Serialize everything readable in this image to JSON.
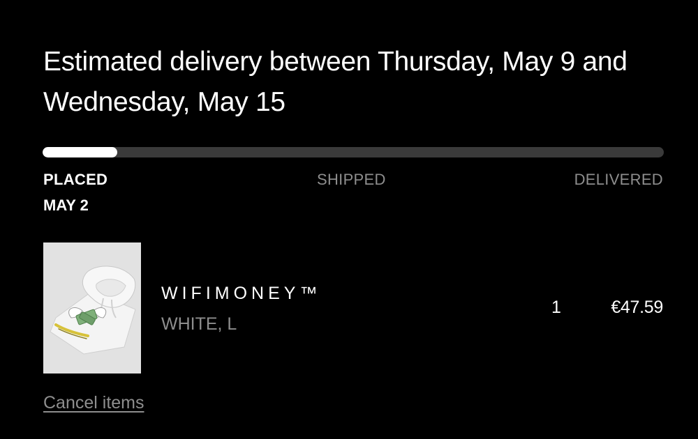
{
  "order": {
    "estimated_delivery": "Estimated delivery between Thursday, May 9 and Wednesday, May 15",
    "progress_fraction": 0.12,
    "steps": [
      {
        "label": "PLACED",
        "date": "MAY 2",
        "active": true
      },
      {
        "label": "SHIPPED",
        "active": false
      },
      {
        "label": "DELIVERED",
        "active": false
      }
    ]
  },
  "item": {
    "name": "WIFIMONEY™",
    "variant": "WHITE, L",
    "quantity": "1",
    "price": "€47.59",
    "thumbnail_icon": "white-hoodie-image"
  },
  "actions": {
    "cancel_label": "Cancel items"
  },
  "colors": {
    "background": "#000000",
    "text_primary": "#ffffff",
    "text_muted": "#8e8e8e",
    "track": "#3a3a3a",
    "fill": "#ffffff"
  }
}
